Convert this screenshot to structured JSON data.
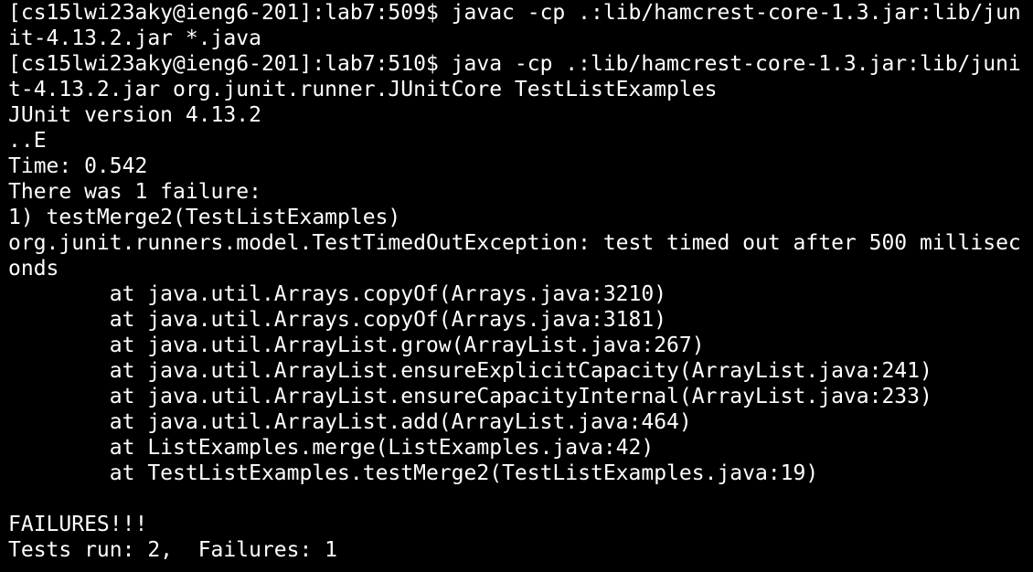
{
  "terminal": {
    "lines": [
      "[cs15lwi23aky@ieng6-201]:lab7:509$ javac -cp .:lib/hamcrest-core-1.3.jar:lib/jun",
      "it-4.13.2.jar *.java",
      "[cs15lwi23aky@ieng6-201]:lab7:510$ java -cp .:lib/hamcrest-core-1.3.jar:lib/juni",
      "t-4.13.2.jar org.junit.runner.JUnitCore TestListExamples",
      "JUnit version 4.13.2",
      "..E",
      "Time: 0.542",
      "There was 1 failure:",
      "1) testMerge2(TestListExamples)",
      "org.junit.runners.model.TestTimedOutException: test timed out after 500 millisec",
      "onds",
      "        at java.util.Arrays.copyOf(Arrays.java:3210)",
      "        at java.util.Arrays.copyOf(Arrays.java:3181)",
      "        at java.util.ArrayList.grow(ArrayList.java:267)",
      "        at java.util.ArrayList.ensureExplicitCapacity(ArrayList.java:241)",
      "        at java.util.ArrayList.ensureCapacityInternal(ArrayList.java:233)",
      "        at java.util.ArrayList.add(ArrayList.java:464)",
      "        at ListExamples.merge(ListExamples.java:42)",
      "        at TestListExamples.testMerge2(TestListExamples.java:19)",
      "",
      "FAILURES!!!",
      "Tests run: 2,  Failures: 1"
    ]
  },
  "colors": {
    "background": "#000000",
    "foreground": "#ffffff"
  }
}
